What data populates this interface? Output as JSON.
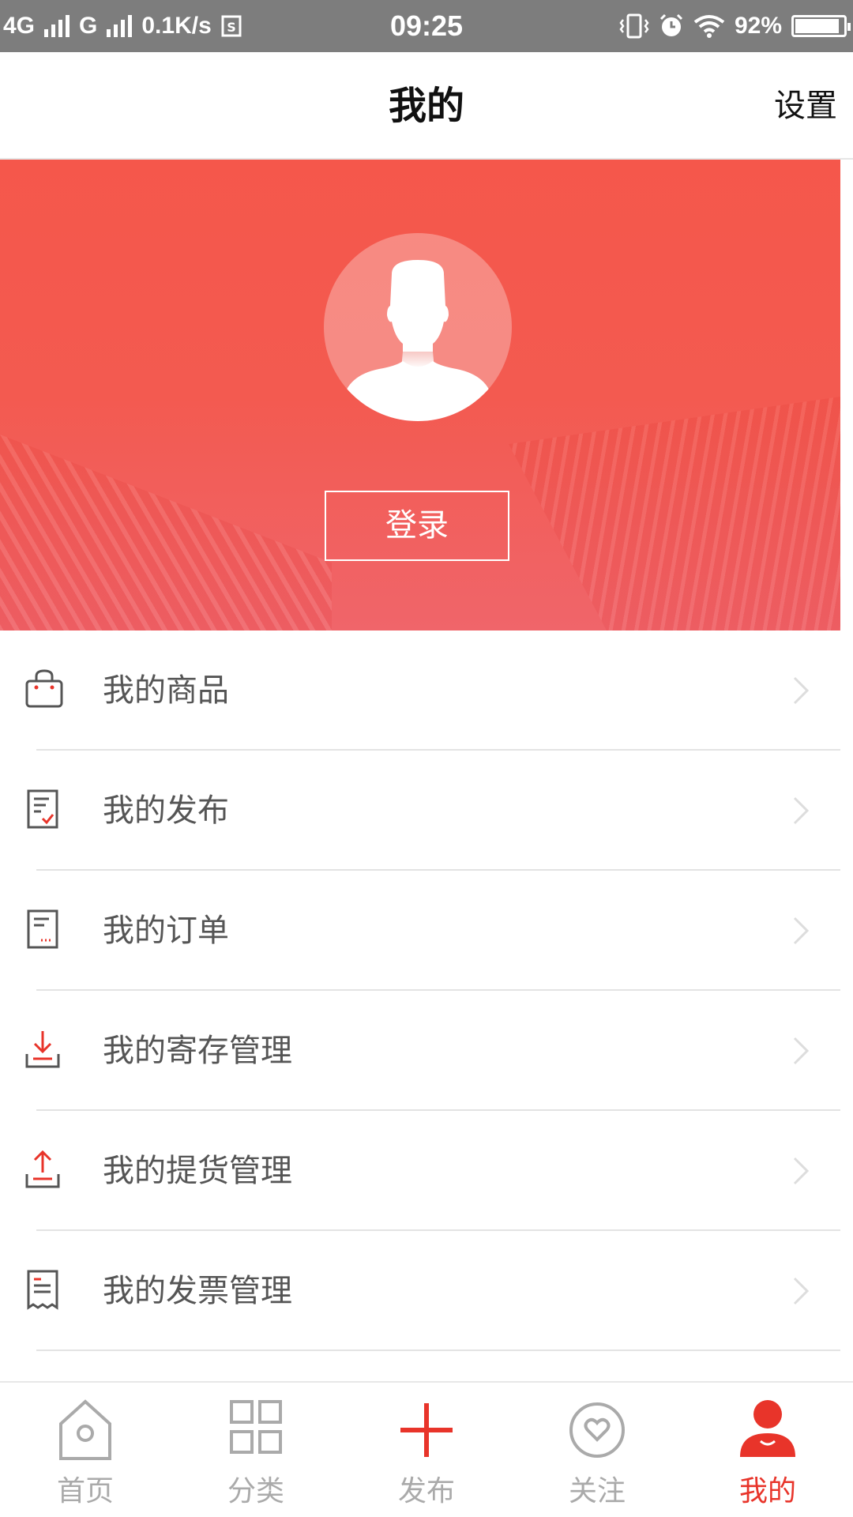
{
  "status_bar": {
    "network1": "4G",
    "network2": "G",
    "speed": "0.1K/s",
    "time": "09:25",
    "battery": "92%",
    "battery_level": 0.92
  },
  "header": {
    "title": "我的",
    "settings_label": "设置"
  },
  "banner": {
    "login_label": "登录"
  },
  "menu": [
    {
      "label": "我的商品",
      "icon": "bag-icon"
    },
    {
      "label": "我的发布",
      "icon": "document-check-icon"
    },
    {
      "label": "我的订单",
      "icon": "order-document-icon"
    },
    {
      "label": "我的寄存管理",
      "icon": "download-tray-icon"
    },
    {
      "label": "我的提货管理",
      "icon": "upload-tray-icon"
    },
    {
      "label": "我的发票管理",
      "icon": "receipt-icon"
    }
  ],
  "nav": [
    {
      "label": "首页",
      "icon": "home-icon",
      "active": false
    },
    {
      "label": "分类",
      "icon": "grid-icon",
      "active": false
    },
    {
      "label": "发布",
      "icon": "plus-icon",
      "active": false
    },
    {
      "label": "关注",
      "icon": "heart-icon",
      "active": false
    },
    {
      "label": "我的",
      "icon": "user-icon",
      "active": true
    }
  ],
  "colors": {
    "accent": "#e8342a",
    "banner": "#f5574b",
    "status_bar": "#7d7d7d"
  }
}
